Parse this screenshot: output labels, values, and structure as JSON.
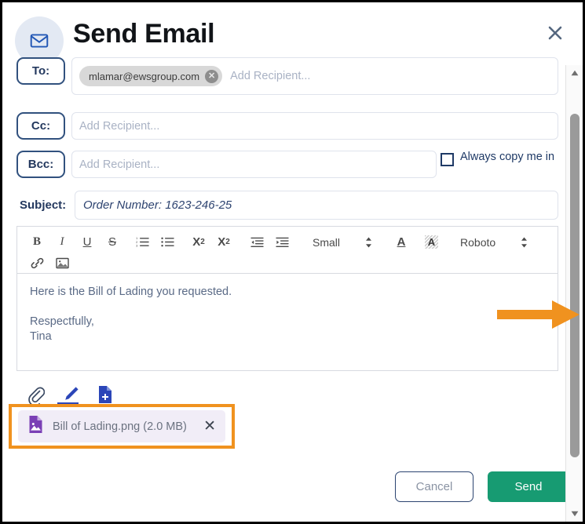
{
  "header": {
    "title": "Send Email",
    "icon": "envelope-icon",
    "close_label": "✕"
  },
  "fields": {
    "to": {
      "label": "To:",
      "placeholder": "Add Recipient...",
      "chips": [
        {
          "text": "mlamar@ewsgroup.com",
          "remove": "✕"
        }
      ]
    },
    "cc": {
      "label": "Cc:",
      "placeholder": "Add Recipient...",
      "value": ""
    },
    "bcc": {
      "label": "Bcc:",
      "placeholder": "Add Recipient...",
      "value": ""
    },
    "always_copy": {
      "label": "Always copy me in",
      "checked": false
    },
    "subject": {
      "label": "Subject:",
      "value": "Order Number: 1623-246-25"
    }
  },
  "toolbar": {
    "bold": "B",
    "italic": "I",
    "underline": "U",
    "strikethrough": "S",
    "ordered_list": "ordered-list-icon",
    "bullet_list": "bullet-list-icon",
    "subscript": "X",
    "subscript_sub": "2",
    "superscript": "X",
    "superscript_sup": "2",
    "outdent": "outdent-icon",
    "indent": "indent-icon",
    "size_value": "Small",
    "font_color": "A",
    "highlight": "A",
    "font_value": "Roboto",
    "link": "link-icon",
    "image": "image-icon"
  },
  "body": {
    "line1": "Here is the Bill of Lading you requested.",
    "line2": "Respectfully,",
    "line3": "Tina"
  },
  "attachments": {
    "actions": [
      {
        "name": "attach-file-icon"
      },
      {
        "name": "signature-icon"
      },
      {
        "name": "add-document-icon"
      }
    ],
    "items": [
      {
        "name": "Bill of Lading.png (2.0 MB)",
        "remove": "✕",
        "icon": "image-file-icon"
      }
    ]
  },
  "footer": {
    "cancel_label": "Cancel",
    "send_label": "Send"
  },
  "annotation": {
    "arrow_color": "#f0921f",
    "highlight_color": "#f0921f"
  },
  "colors": {
    "accent_navy": "#23385e",
    "send_green": "#179b72",
    "attachment_purple": "#7a3fb5",
    "highlight_orange": "#f0921f"
  }
}
